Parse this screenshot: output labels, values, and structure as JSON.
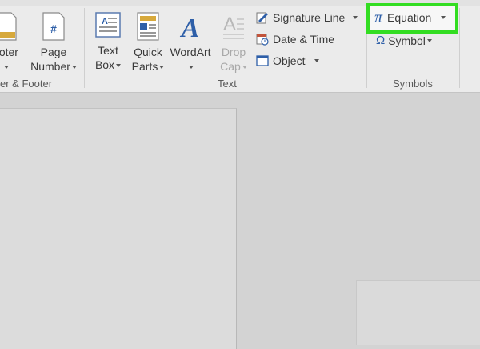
{
  "ribbon": {
    "header_footer": {
      "footer_label_line1": "ooter",
      "group_label": "er & Footer"
    },
    "page_number": {
      "line1": "Page",
      "line2": "Number"
    },
    "text_group": {
      "text_box": {
        "line1": "Text",
        "line2": "Box"
      },
      "quick_parts": {
        "line1": "Quick",
        "line2": "Parts"
      },
      "wordart": {
        "line1": "WordArt"
      },
      "drop_cap": {
        "line1": "Drop",
        "line2": "Cap"
      },
      "signature_line": "Signature Line",
      "date_time": "Date & Time",
      "object": "Object",
      "group_label": "Text"
    },
    "symbols_group": {
      "equation": "Equation",
      "symbol": "Symbol",
      "group_label": "Symbols",
      "pi_glyph": "π",
      "omega_glyph": "Ω"
    }
  },
  "colors": {
    "highlight": "#33dd22",
    "accent_blue": "#2e5fa8",
    "ribbon_bg": "#ebebeb"
  }
}
